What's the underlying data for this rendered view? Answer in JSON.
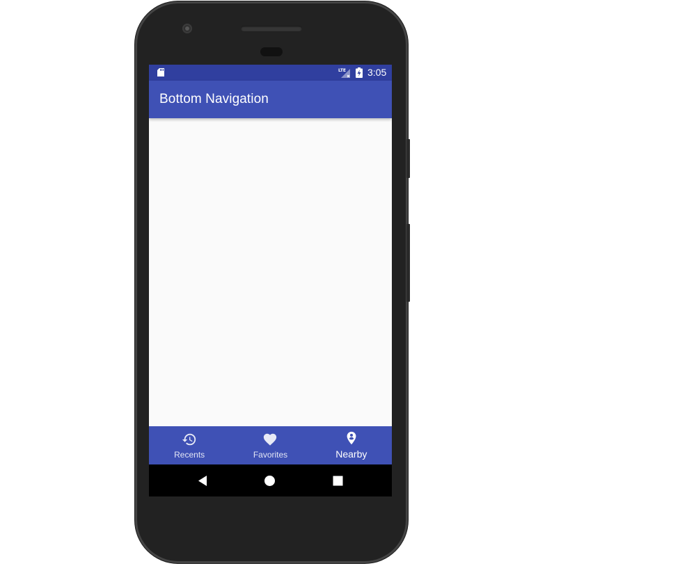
{
  "status_bar": {
    "network_label": "LTE",
    "time": "3:05"
  },
  "app_bar": {
    "title": "Bottom Navigation"
  },
  "bottom_nav": {
    "items": [
      {
        "label": "Recents",
        "icon": "history-icon",
        "active": false
      },
      {
        "label": "Favorites",
        "icon": "heart-icon",
        "active": false
      },
      {
        "label": "Nearby",
        "icon": "location-pin-icon",
        "active": true
      }
    ]
  },
  "system_nav": {
    "buttons": [
      "back-triangle-icon",
      "home-circle-icon",
      "recents-square-icon"
    ]
  },
  "colors": {
    "status_bar": "#303f9f",
    "primary": "#3f51b5",
    "background": "#fafafa",
    "phone_body": "#222222",
    "system_nav": "#000000"
  }
}
